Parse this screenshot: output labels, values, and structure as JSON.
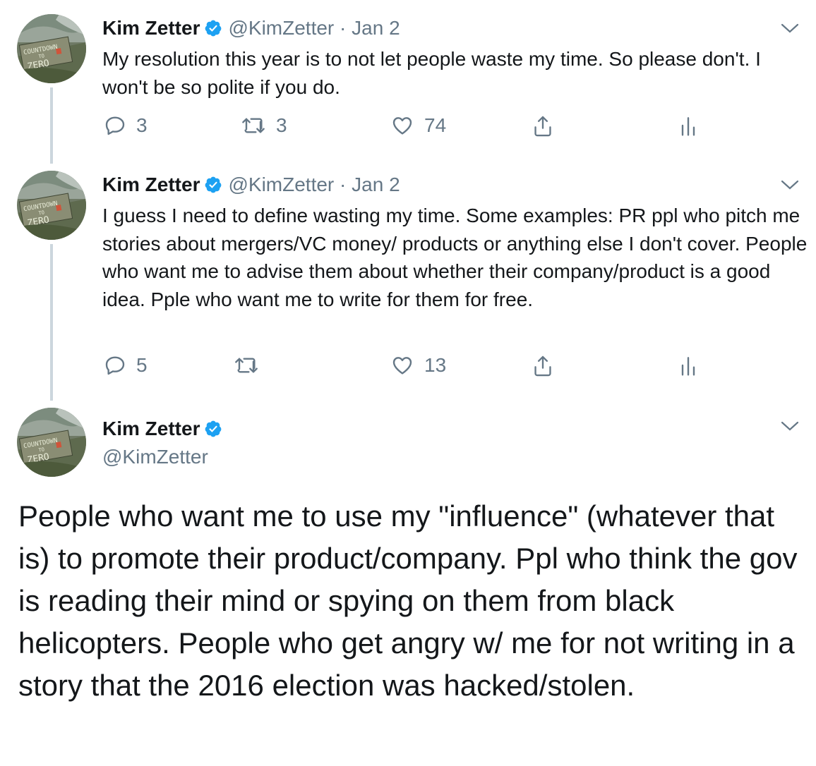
{
  "tweets": [
    {
      "name": "Kim Zetter",
      "handle": "@KimZetter",
      "separator": "·",
      "date": "Jan 2",
      "text": "My resolution this year is to not let people waste my time.  So please don't. I won't be so polite if you do.",
      "replies": "3",
      "retweets": "3",
      "likes": "74"
    },
    {
      "name": "Kim Zetter",
      "handle": "@KimZetter",
      "separator": "·",
      "date": "Jan 2",
      "text": "I guess I need to define wasting my time. Some examples: PR ppl who pitch me stories about mergers/VC money/ products or anything else I don't cover. People who want me to advise them about whether their company/product is a good idea. Pple who want me to write for them for free.",
      "replies": "5",
      "retweets": "",
      "likes": "13"
    },
    {
      "name": "Kim Zetter",
      "handle": "@KimZetter",
      "text": "People who want me to use my \"influence\" (whatever that is) to promote their product/company. Ppl who think the gov is reading their mind or spying on them from black helicopters. People who get angry w/ me for not writing in a story that the 2016 election was hacked/stolen."
    }
  ],
  "colors": {
    "text": "#14171a",
    "secondary": "#657786",
    "verified": "#1da1f2",
    "thread_line": "#ccd6dd"
  },
  "icons": [
    "reply-icon",
    "retweet-icon",
    "like-icon",
    "share-icon",
    "analytics-icon",
    "chevron-down-icon",
    "verified-badge-icon"
  ]
}
